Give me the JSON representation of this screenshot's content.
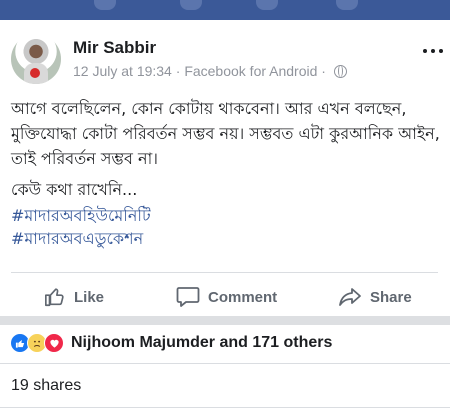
{
  "post": {
    "author": "Mir Sabbir",
    "date": "12 July at 19:34",
    "separator": "·",
    "source": "Facebook for Android",
    "privacy_icon": "globe-icon",
    "body_paragraph_1": "আগে বলেছিলেন, কোন কোটায় থাকবেনা। আর এখন বলছেন, মুক্তিযোদ্ধা কোটা পরিবর্তন সম্ভব নয়। সম্ভবত এটা কুরআনিক আইন, তাই পরিবর্তন সম্ভব না।",
    "body_paragraph_2": "কেউ কথা রাখেনি...",
    "hashtags": [
      "#মাদারঅবহিউমেনিটি",
      "#মাদারঅবএডুকেশন"
    ]
  },
  "actions": {
    "like_label": "Like",
    "comment_label": "Comment",
    "share_label": "Share"
  },
  "reactions": {
    "types": [
      "like",
      "sad",
      "love"
    ],
    "summary": "Nijhoom Majumder and 171 others"
  },
  "shares_text": "19 shares",
  "colors": {
    "header_bar": "#3b5998",
    "link": "#365899",
    "muted": "#90949c",
    "action": "#606770"
  }
}
